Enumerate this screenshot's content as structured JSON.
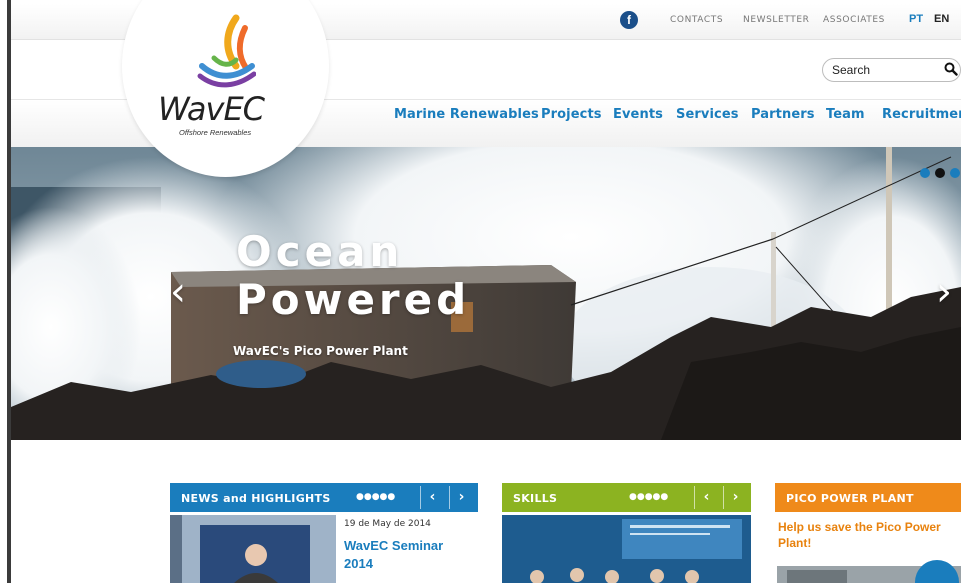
{
  "topbar": {
    "facebook_icon": "facebook-icon",
    "links": [
      "CONTACTS",
      "NEWSLETTER",
      "ASSOCIATES"
    ],
    "languages": [
      "PT",
      "EN"
    ]
  },
  "logo": {
    "name": "WavEC",
    "tagline": "Offshore Renewables"
  },
  "search": {
    "placeholder": "Search",
    "icon": "search-icon"
  },
  "nav": {
    "items": [
      "Marine Renewables",
      "Projects",
      "Events",
      "Services",
      "Partners",
      "Team",
      "Recruitment"
    ]
  },
  "hero": {
    "title_line1": "Ocean",
    "title_line2": "Powered",
    "subtitle": "WavEC's Pico Power Plant",
    "prev_arrow": "‹",
    "next_arrow": "›",
    "slide_count": 3,
    "active_slide": 2
  },
  "panels": {
    "news": {
      "title": "NEWS and HIGHLIGHTS",
      "color": "#1a7dbd",
      "dots": "●●●●●",
      "date": "19 de May de 2014",
      "headline": "WavEC Seminar 2014"
    },
    "skills": {
      "title": "SKILLS",
      "color": "#8cb321",
      "dots": "●●●●●"
    },
    "pico": {
      "title": "PICO POWER PLANT",
      "color": "#ef8a1a",
      "text": "Help us save the Pico Power Plant!"
    },
    "prev_label": "‹",
    "next_label": "›"
  }
}
